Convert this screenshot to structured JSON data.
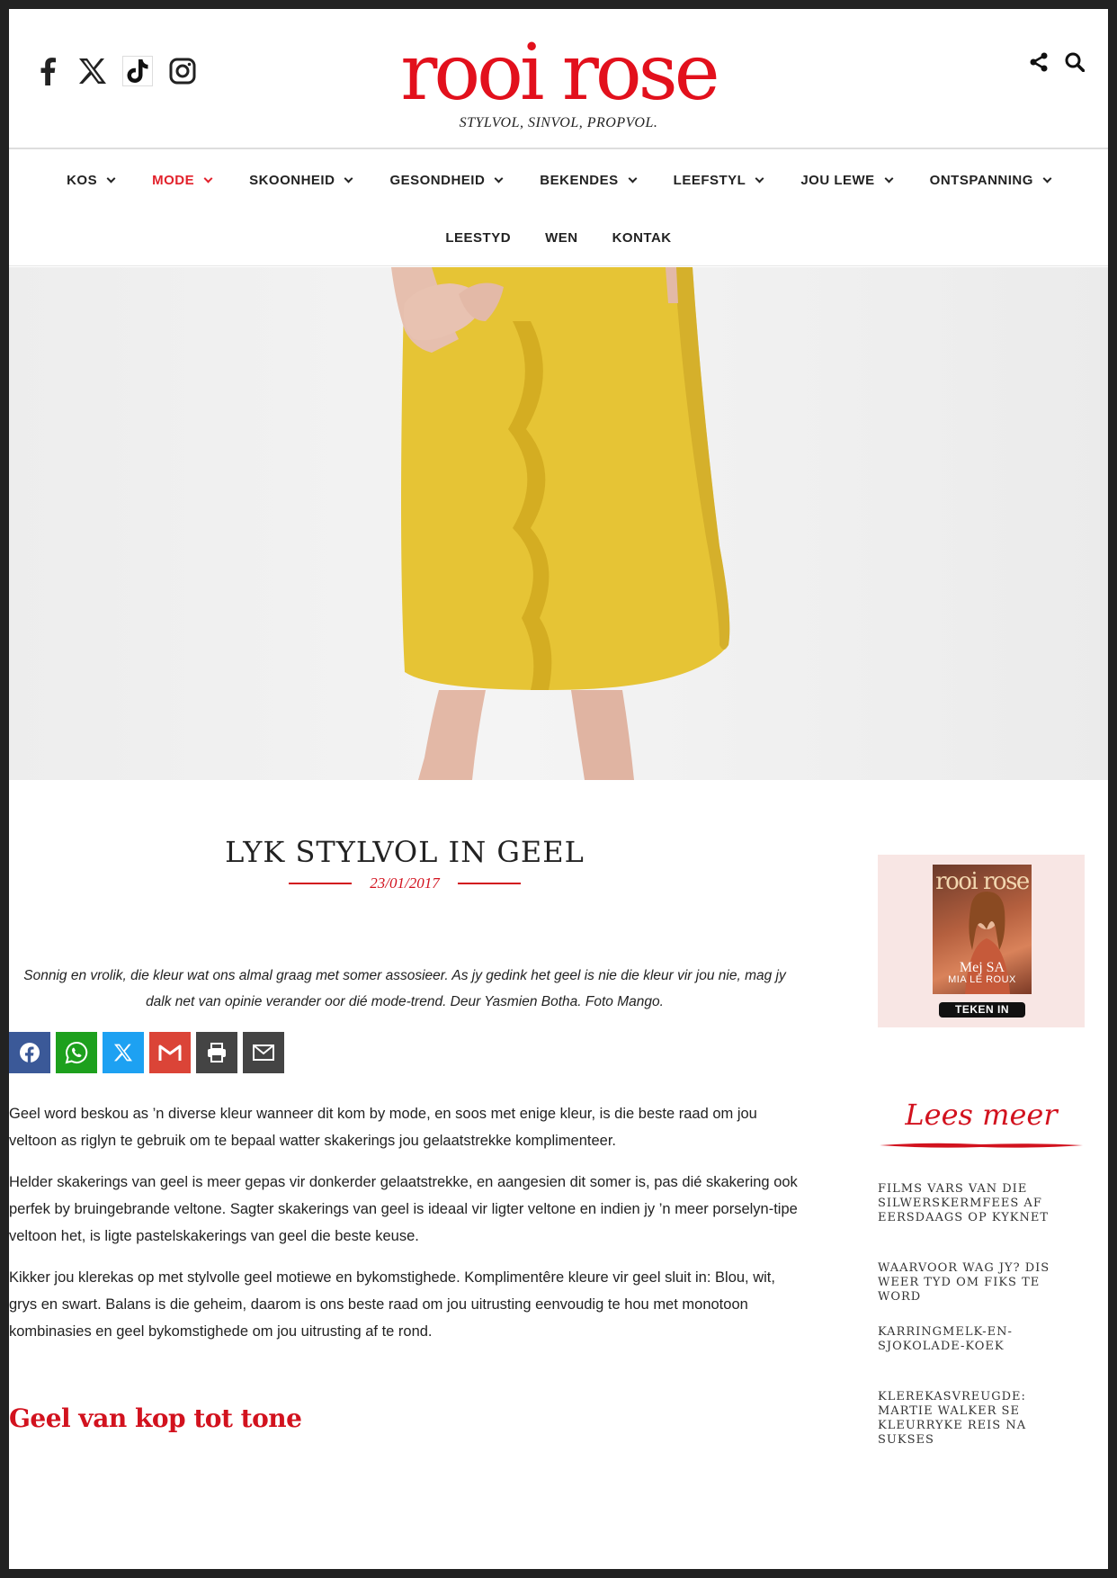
{
  "header": {
    "logo_text": "rooi rose",
    "tagline": "STYLVOL, SINVOL, PROPVOL.",
    "social_icons": [
      "facebook-icon",
      "x-icon",
      "tiktok-icon",
      "instagram-icon"
    ],
    "tool_icons": [
      "share-icon",
      "search-icon"
    ]
  },
  "nav": {
    "row1": [
      {
        "label": "KOS",
        "has_dropdown": true
      },
      {
        "label": "MODE",
        "has_dropdown": true,
        "active": true
      },
      {
        "label": "SKOONHEID",
        "has_dropdown": true
      },
      {
        "label": "GESONDHEID",
        "has_dropdown": true
      },
      {
        "label": "BEKENDES",
        "has_dropdown": true
      },
      {
        "label": "LEEFSTYL",
        "has_dropdown": true
      },
      {
        "label": "JOU LEWE",
        "has_dropdown": true
      },
      {
        "label": "ONTSPANNING",
        "has_dropdown": true
      }
    ],
    "row2": [
      {
        "label": "LEESTYD"
      },
      {
        "label": "WEN"
      },
      {
        "label": "KONTAK"
      }
    ],
    "active_color": "#e2212b"
  },
  "article": {
    "title": "LYK STYLVOL IN GEEL",
    "date": "23/01/2017",
    "intro": "Sonnig en vrolik, die kleur wat ons almal graag met somer assosieer. As jy gedink het geel is nie die kleur vir jou nie, mag jy dalk net van opinie verander oor dié mode-trend. Deur Yasmien Botha. Foto Mango.",
    "share_buttons": [
      {
        "icon": "facebook-icon",
        "color": "#3b5998"
      },
      {
        "icon": "whatsapp-icon",
        "color": "#1da01d"
      },
      {
        "icon": "x-icon",
        "color": "#1da1f2"
      },
      {
        "icon": "gmail-icon",
        "color": "#db4437"
      },
      {
        "icon": "print-icon",
        "color": "#444444"
      },
      {
        "icon": "email-icon",
        "color": "#444444"
      }
    ],
    "paragraphs": [
      "Geel word beskou as ’n diverse kleur wanneer dit kom by mode, en soos met enige kleur, is die beste raad om jou veltoon as riglyn te gebruik om te bepaal watter skakerings jou gelaatstrekke komplimenteer.",
      "Helder skakerings van geel is meer gepas vir donkerder gelaatstrekke, en aangesien dit somer is, pas dié skakering ook perfek by bruingebrande veltone. Sagter skakerings van geel is ideaal vir ligter veltone en indien jy ’n meer porselyn-tipe veltoon het, is ligte pastelskakerings van geel die beste keuse.",
      "Kikker jou klerekas op met stylvolle geel motiewe en bykomstighede. Komplimentêre kleure vir geel sluit in: Blou, wit, grys en swart. Balans is die geheim, daarom is ons beste raad om jou uitrusting eenvoudig te hou met monotoon kombinasies en geel bykomstighede om jou uitrusting af te rond."
    ],
    "subheading": "Geel van kop tot tone"
  },
  "sidebar": {
    "magazine": {
      "logo": "rooi rose",
      "name_line1": "Mej SA",
      "name_line2": "MIA LE ROUX",
      "button_label": "TEKEN IN"
    },
    "lees_meer": "Lees meer",
    "related": [
      "FILMS VARS VAN DIE SILWERSKERMFEES AF EERSDAAGS OP KYKNET",
      "WAARVOOR WAG JY? DIS WEER TYD OM FIKS TE WORD",
      "KARRINGMELK-EN-SJOKOLADE-KOEK",
      "KLEREKASVREUGDE: MARTIE WALKER SE KLEURRYKE REIS NA SUKSES"
    ]
  },
  "colors": {
    "brand_red": "#e2101c",
    "dress_yellow": "#e6c435"
  }
}
